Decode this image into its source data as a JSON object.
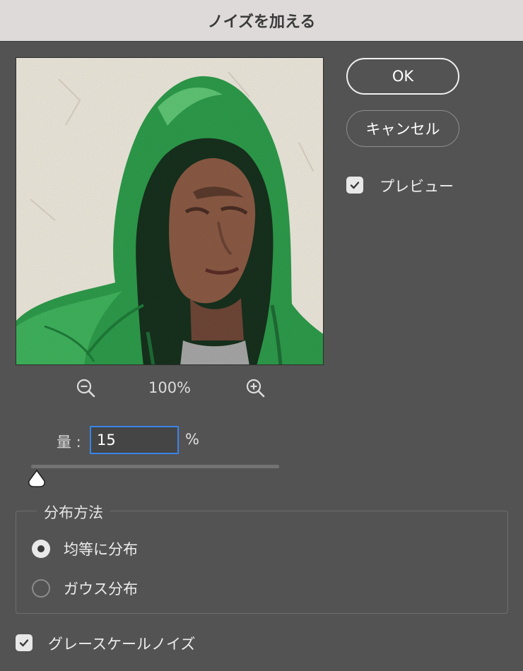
{
  "dialog": {
    "title": "ノイズを加える"
  },
  "zoom": {
    "value": "100%"
  },
  "buttons": {
    "ok": "OK",
    "cancel": "キャンセル"
  },
  "preview_option": {
    "label": "プレビュー",
    "checked": true
  },
  "amount": {
    "label": "量 :",
    "value": "15",
    "unit": "%"
  },
  "distribution": {
    "title": "分布方法",
    "options": [
      {
        "label": "均等に分布",
        "selected": true
      },
      {
        "label": "ガウス分布",
        "selected": false
      }
    ]
  },
  "grayscale_option": {
    "label": "グレースケールノイズ",
    "checked": true
  },
  "colors": {
    "accent": "#3a84e6",
    "dialog_bg": "#535353",
    "titlebar_bg": "#dedad9"
  }
}
